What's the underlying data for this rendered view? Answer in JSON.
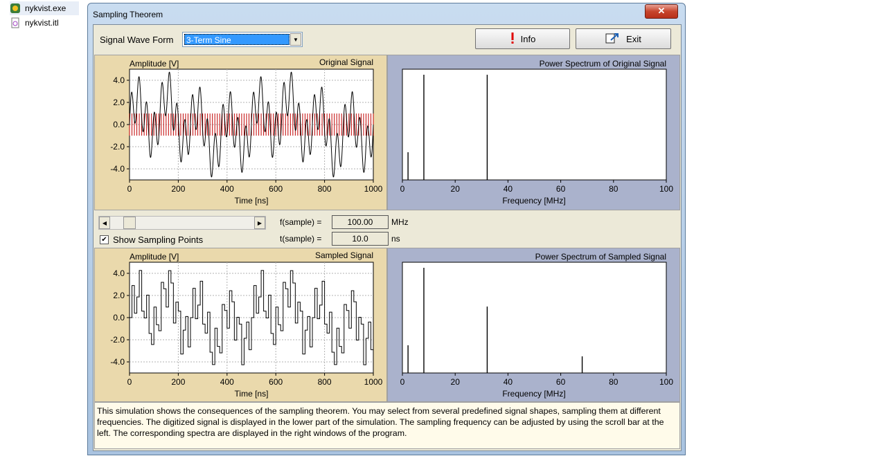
{
  "desktop": {
    "items": [
      {
        "name": "nykvist.exe"
      },
      {
        "name": "nykvist.itl"
      }
    ]
  },
  "window": {
    "title": "Sampling Theorem",
    "close_label": "✕"
  },
  "controls": {
    "signal_label": "Signal Wave Form",
    "signal_value": "3-Term Sine",
    "info_label": "Info",
    "exit_label": "Exit"
  },
  "sampling": {
    "f_label": "f(sample) =",
    "f_value": "100.00",
    "f_unit": "MHz",
    "t_label": "t(sample) =",
    "t_value": "10.0",
    "t_unit": "ns",
    "show_points_label": "Show Sampling Points",
    "show_points_checked": true,
    "slider_position": 0.1
  },
  "colors": {
    "sample_lines": "#c00000",
    "plot_bg": "#ffffff",
    "tan_panel": "#ead9ac",
    "blue_panel": "#aab2cc"
  },
  "chart_data": [
    {
      "type": "line",
      "panel_label": "Original Signal",
      "ylabel": "Amplitude [V]",
      "xlabel": "Time [ns]",
      "xlim": [
        0,
        1000
      ],
      "ylim": [
        -5,
        5
      ],
      "xticks": [
        0,
        200,
        400,
        600,
        800,
        1000
      ],
      "yticks": [
        4.0,
        2.0,
        0.0,
        -2.0,
        -4.0
      ],
      "grid": true,
      "sampling_lines_ylim": [
        -1,
        1
      ],
      "sampling_interval_ns": 10,
      "components": [
        {
          "freq_mhz": 2,
          "amp": 1.0
        },
        {
          "freq_mhz": 8,
          "amp": 2.0
        },
        {
          "freq_mhz": 32,
          "amp": 2.0
        }
      ]
    },
    {
      "type": "bar",
      "title": "Power Spectrum of Original Signal",
      "xlabel": "Frequency [MHz]",
      "xlim": [
        0,
        100
      ],
      "xticks": [
        0,
        20,
        40,
        60,
        80,
        100
      ],
      "ylim": [
        0,
        1
      ],
      "x": [
        2,
        8,
        32
      ],
      "values": [
        0.25,
        0.95,
        0.95
      ]
    },
    {
      "type": "line",
      "panel_label": "Sampled Signal",
      "ylabel": "Amplitude [V]",
      "xlabel": "Time [ns]",
      "xlim": [
        0,
        1000
      ],
      "ylim": [
        -5,
        5
      ],
      "xticks": [
        0,
        200,
        400,
        600,
        800,
        1000
      ],
      "yticks": [
        4.0,
        2.0,
        0.0,
        -2.0,
        -4.0
      ],
      "grid": true,
      "step": true,
      "sampling_interval_ns": 10
    },
    {
      "type": "bar",
      "title": "Power Spectrum of Sampled Signal",
      "xlabel": "Frequency [MHz]",
      "xlim": [
        0,
        100
      ],
      "xticks": [
        0,
        20,
        40,
        60,
        80,
        100
      ],
      "ylim": [
        0,
        1
      ],
      "x": [
        2,
        8,
        32,
        68
      ],
      "values": [
        0.25,
        0.95,
        0.6,
        0.15
      ]
    }
  ],
  "description": "This simulation shows the consequences of the sampling theorem. You may select from several predefined signal shapes, sampling them at different frequencies. The digitized signal is displayed in the lower part of the simulation. The sampling frequency can be adjusted by using the scroll bar at the left. The corresponding spectra are displayed in the right windows of the program."
}
